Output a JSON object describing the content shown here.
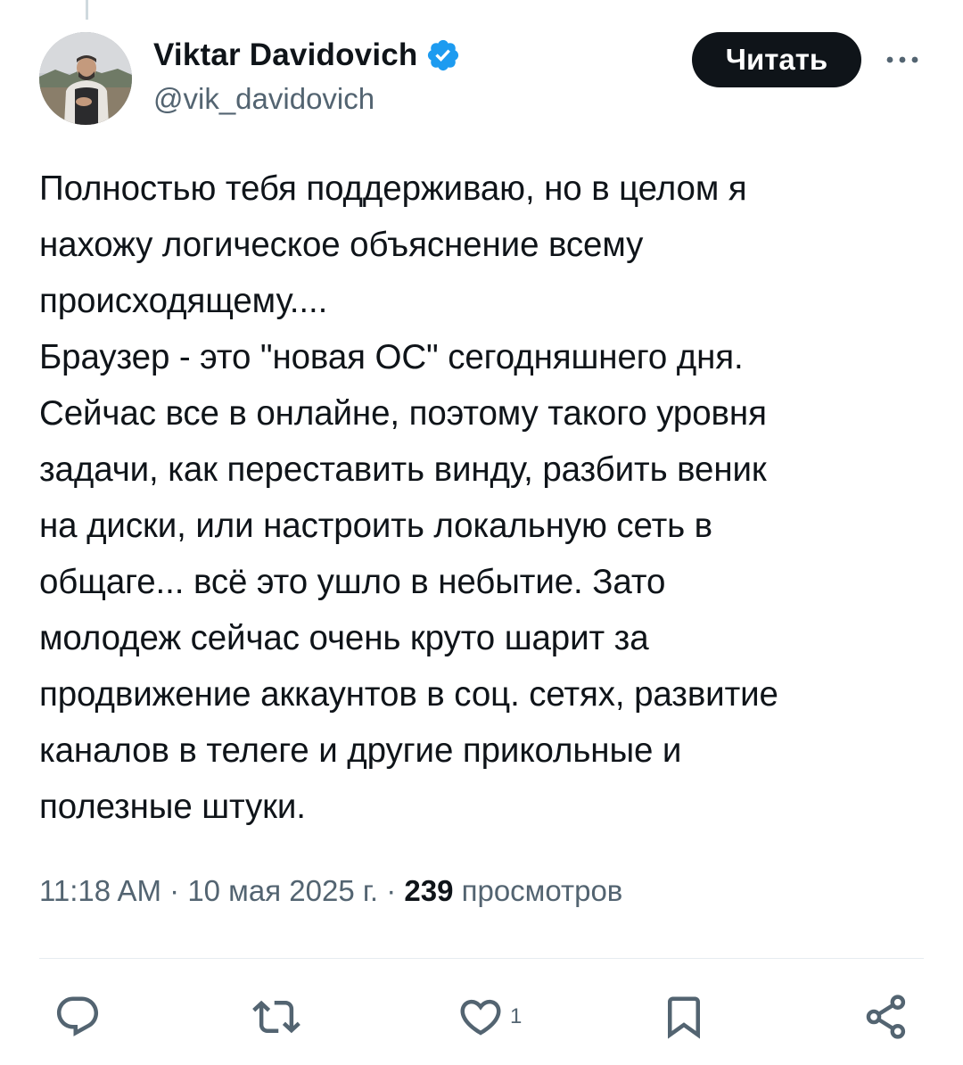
{
  "author": {
    "display_name": "Viktar Davidovich",
    "handle": "@vik_davidovich",
    "verified": true
  },
  "follow_button": {
    "label": "Читать"
  },
  "tweet": {
    "text": "Полностью тебя поддерживаю, но в целом я\nнахожу логическое объяснение всему\nпроисходящему....\nБраузер - это \"новая ОС\" сегодняшнего дня.\nСейчас все в онлайне, поэтому такого уровня\nзадачи, как переставить винду, разбить веник\nна диски, или настроить локальную сеть в\nобщаге... всё это ушло в небытие. Зато\nмолодеж сейчас очень круто шарит за\nпродвижение аккаунтов в соц. сетях, развитие\nканалов в телеге и другие прикольные и\nполезные штуки.",
    "time": "11:18 AM",
    "separator": " · ",
    "date": "10 мая 2025 г.",
    "views_count": "239",
    "views_label": "просмотров"
  },
  "actions": {
    "reply": {
      "icon": "reply-icon"
    },
    "retweet": {
      "icon": "retweet-icon"
    },
    "like": {
      "icon": "heart-icon",
      "count": "1"
    },
    "bookmark": {
      "icon": "bookmark-icon"
    },
    "share": {
      "icon": "share-icon"
    }
  },
  "colors": {
    "text_primary": "#0f1419",
    "text_secondary": "#536471",
    "verified_blue": "#1d9bf0",
    "button_bg": "#0f1419",
    "divider": "#e6ecf0"
  }
}
